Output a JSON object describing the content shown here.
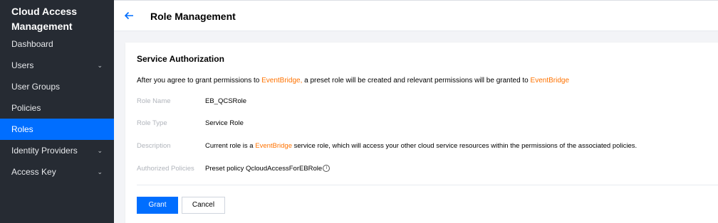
{
  "sidebar": {
    "title": "Cloud Access Management",
    "items": [
      {
        "label": "Dashboard",
        "has_children": false,
        "active": false
      },
      {
        "label": "Users",
        "has_children": true,
        "active": false
      },
      {
        "label": "User Groups",
        "has_children": false,
        "active": false
      },
      {
        "label": "Policies",
        "has_children": false,
        "active": false
      },
      {
        "label": "Roles",
        "has_children": false,
        "active": true
      },
      {
        "label": "Identity Providers",
        "has_children": true,
        "active": false
      },
      {
        "label": "Access Key",
        "has_children": true,
        "active": false
      }
    ]
  },
  "header": {
    "back_icon": "arrow-left-icon",
    "title": "Role Management"
  },
  "card": {
    "title": "Service Authorization",
    "notice": {
      "part1": "After you agree to grant permissions to ",
      "link1": "EventBridge,",
      "part2": " a preset role will be created and relevant permissions will be granted to ",
      "link2": "EventBridge"
    },
    "details": {
      "role_name_label": "Role Name",
      "role_name_value": "EB_QCSRole",
      "role_type_label": "Role Type",
      "role_type_value": "Service Role",
      "description_label": "Description",
      "description_part1": "Current role is a ",
      "description_link": "EventBridge",
      "description_part2": " service role, which will access your other cloud service resources within the permissions of the associated policies.",
      "policies_label": "Authorized Policies",
      "policies_value": "Preset policy QcloudAccessForEBRole",
      "info_icon": "info-circle-icon"
    },
    "buttons": {
      "grant": "Grant",
      "cancel": "Cancel"
    }
  },
  "colors": {
    "accent": "#006eff",
    "link": "#ff7200",
    "sidebar_bg": "#262b33"
  }
}
